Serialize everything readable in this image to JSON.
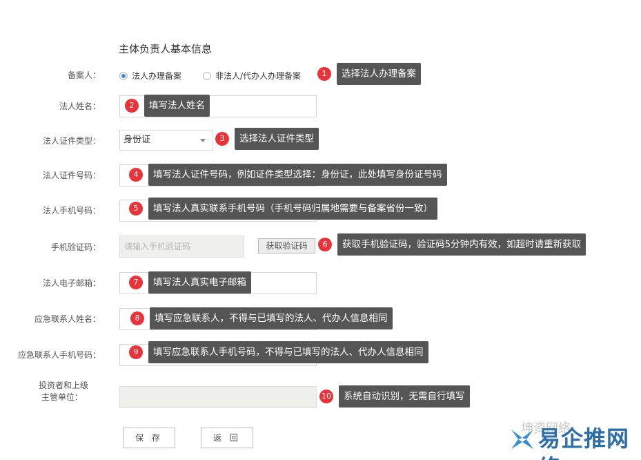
{
  "section_title": "主体负责人基本信息",
  "fields": {
    "filer_label": "备案人：",
    "radio_legal": "法人办理备案",
    "radio_agent": "非法人/代办人办理备案",
    "name_label": "法人姓名：",
    "id_type_label": "法人证件类型：",
    "id_type_value": "身份证",
    "id_number_label": "法人证件号码：",
    "phone_label": "法人手机号码：",
    "code_label": "手机验证码：",
    "code_placeholder": "请输入手机验证码",
    "get_code_button": "获取验证码",
    "email_label": "法人电子邮箱：",
    "emergency_name_label": "应急联系人姓名：",
    "emergency_phone_label": "应急联系人手机号码：",
    "investor_label_line1": "投资者和上级",
    "investor_label_line2": "主管单位："
  },
  "buttons": {
    "save": "保 存",
    "back": "返 回"
  },
  "annotations": [
    {
      "num": "1",
      "text": "选择法人办理备案"
    },
    {
      "num": "2",
      "text": "填写法人姓名"
    },
    {
      "num": "3",
      "text": "选择法人证件类型"
    },
    {
      "num": "4",
      "text": "填写法人证件号码，例如证件类型选择：身份证，此处填写身份证号码"
    },
    {
      "num": "5",
      "text": "填写法人真实联系手机号码（手机号码归属地需要与备案省份一致）"
    },
    {
      "num": "6",
      "text": "获取手机验证码，验证码5分钟内有效，如超时请重新获取"
    },
    {
      "num": "7",
      "text": "填写法人真实电子邮箱"
    },
    {
      "num": "8",
      "text": "填写应急联系人，不得与已填写的法人、代办人信息相同"
    },
    {
      "num": "9",
      "text": "填写应急联系人手机号码，不得与已填写的法人、代办人信息相同"
    },
    {
      "num": "10",
      "text": "系统自动识别，无需自行填写"
    }
  ],
  "watermark": {
    "text": "坤资网络",
    "brand": "易企推网络"
  },
  "colors": {
    "annotation_badge": "#e8333a",
    "tooltip_bg": "#555555",
    "radio_selected": "#3b8ad9",
    "brand": "#2c6ea8"
  }
}
